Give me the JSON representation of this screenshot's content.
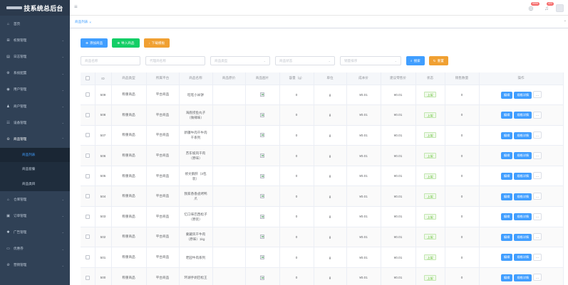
{
  "app": {
    "logo": "技系统总后台"
  },
  "sidebar": {
    "items": [
      {
        "label": "首页",
        "icon": "home-icon",
        "glyph": "⌂",
        "arrow": ""
      },
      {
        "label": "权限管理",
        "icon": "lock-icon",
        "glyph": "⊞",
        "arrow": "⌄"
      },
      {
        "label": "日志管理",
        "icon": "log-icon",
        "glyph": "▤",
        "arrow": "⌄"
      },
      {
        "label": "系统配置",
        "icon": "gear-icon",
        "glyph": "⚙",
        "arrow": "⌄"
      },
      {
        "label": "用户管理",
        "icon": "user-icon",
        "glyph": "◉",
        "arrow": "⌄"
      },
      {
        "label": "商户管理",
        "icon": "merchant-icon",
        "glyph": "♟",
        "arrow": "⌄"
      },
      {
        "label": "设备管理",
        "icon": "device-icon",
        "glyph": "☷",
        "arrow": "⌄"
      },
      {
        "label": "商品管理",
        "icon": "goods-icon",
        "glyph": "⊙",
        "arrow": "⌃"
      }
    ],
    "sub_items": [
      {
        "label": "商品列表",
        "active": true
      },
      {
        "label": "商品套餐",
        "active": false
      },
      {
        "label": "商品类目",
        "active": false
      }
    ],
    "items_after": [
      {
        "label": "仓库管理",
        "icon": "warehouse-icon",
        "glyph": "⌂",
        "arrow": "⌄"
      },
      {
        "label": "订单管理",
        "icon": "order-icon",
        "glyph": "▣",
        "arrow": "⌄"
      },
      {
        "label": "广告管理",
        "icon": "ad-icon",
        "glyph": "✱",
        "arrow": "⌄"
      },
      {
        "label": "优惠券",
        "icon": "coupon-icon",
        "glyph": "▭",
        "arrow": "⌄"
      },
      {
        "label": "营销管理",
        "icon": "marketing-icon",
        "glyph": "⊘",
        "arrow": "⌄"
      }
    ]
  },
  "header": {
    "hamburger": "≡",
    "badge1": "9999",
    "badge2": "422"
  },
  "tabs": {
    "active_label": "商品列表",
    "close": "×",
    "arrow": "⌄"
  },
  "toolbar": {
    "add_label": "添加商品",
    "import_label": "导入商品",
    "download_label": "下载模板",
    "add_icon": "⊕",
    "import_icon": "⊕",
    "download_icon": "↓"
  },
  "filters": {
    "name_placeholder": "商品名称",
    "platform_placeholder": "代理商名称",
    "type_placeholder": "商品类型",
    "status_placeholder": "商品状态",
    "sort_placeholder": "销量排序",
    "search_label": "搜索",
    "reset_label": "重置",
    "search_icon": "⌕",
    "reset_icon": "↻",
    "select_arrow": "⌄"
  },
  "table": {
    "columns": [
      "",
      "ID",
      "商品类型",
      "所属平台",
      "商品名称",
      "商品原价",
      "商品图片",
      "容量（g）",
      "单位",
      "成本价",
      "建议零售价",
      "状态",
      "销售数量",
      "操作"
    ],
    "edit_label": "编辑",
    "price_label": "规格详情",
    "more_label": "...",
    "rows": [
      {
        "id": "509",
        "type": "称重商品",
        "platform": "平台商品",
        "name": "旺旺小米饼",
        "orig": "",
        "capacity": "0",
        "unit": "g",
        "cost": "¥0.01",
        "retail": "¥0.01",
        "status": "上架",
        "sales": "0"
      },
      {
        "id": "508",
        "type": "称重商品",
        "platform": "平台商品",
        "name": "海底捞鱼丸子（微辣味）",
        "orig": "",
        "capacity": "0",
        "unit": "g",
        "cost": "¥0.01",
        "retail": "¥0.01",
        "status": "上架",
        "sales": "0"
      },
      {
        "id": "507",
        "type": "称重商品",
        "platform": "平台商品",
        "name": "新疆牛肉干牛肉干系列",
        "orig": "",
        "capacity": "0",
        "unit": "g",
        "cost": "¥0.01",
        "retail": "¥0.01",
        "status": "上架",
        "sales": "0"
      },
      {
        "id": "506",
        "type": "称重商品",
        "platform": "平台商品",
        "name": "苏东坡风干肉（原味）",
        "orig": "",
        "capacity": "0",
        "unit": "g",
        "cost": "¥0.01",
        "retail": "¥0.01",
        "status": "上架",
        "sales": "0"
      },
      {
        "id": "505",
        "type": "称重商品",
        "platform": "平台商品",
        "name": "修文鹅肝（3包装）",
        "orig": "",
        "capacity": "0",
        "unit": "g",
        "cost": "¥0.01",
        "retail": "¥0.01",
        "status": "上架",
        "sales": "0"
      },
      {
        "id": "504",
        "type": "称重商品",
        "platform": "平台商品",
        "name": "我家香香卤烤鸭爪",
        "orig": "",
        "capacity": "0",
        "unit": "g",
        "cost": "¥0.01",
        "retail": "¥0.01",
        "status": "上架",
        "sales": "0"
      },
      {
        "id": "503",
        "type": "称重商品",
        "platform": "平台商品",
        "name": "忆口味巴西松子（原装）",
        "orig": "",
        "capacity": "0",
        "unit": "g",
        "cost": "¥0.01",
        "retail": "¥0.01",
        "status": "上架",
        "sales": "0"
      },
      {
        "id": "502",
        "type": "称重商品",
        "platform": "平台商品",
        "name": "蒙藏风干牛肉（原味）1kg",
        "orig": "",
        "capacity": "0",
        "unit": "g",
        "cost": "¥0.01",
        "retail": "¥0.01",
        "status": "上架",
        "sales": "0"
      },
      {
        "id": "501",
        "type": "称重商品",
        "platform": "平台商品",
        "name": "老园牛肉系列",
        "orig": "",
        "capacity": "0",
        "unit": "g",
        "cost": "¥0.01",
        "retail": "¥0.01",
        "status": "上架",
        "sales": "0"
      },
      {
        "id": "500",
        "type": "称重商品",
        "platform": "平台商品",
        "name": "环湖手剥巴松王",
        "orig": "",
        "capacity": "0",
        "unit": "g",
        "cost": "¥0.01",
        "retail": "¥0.01",
        "status": "上架",
        "sales": "0"
      }
    ]
  }
}
